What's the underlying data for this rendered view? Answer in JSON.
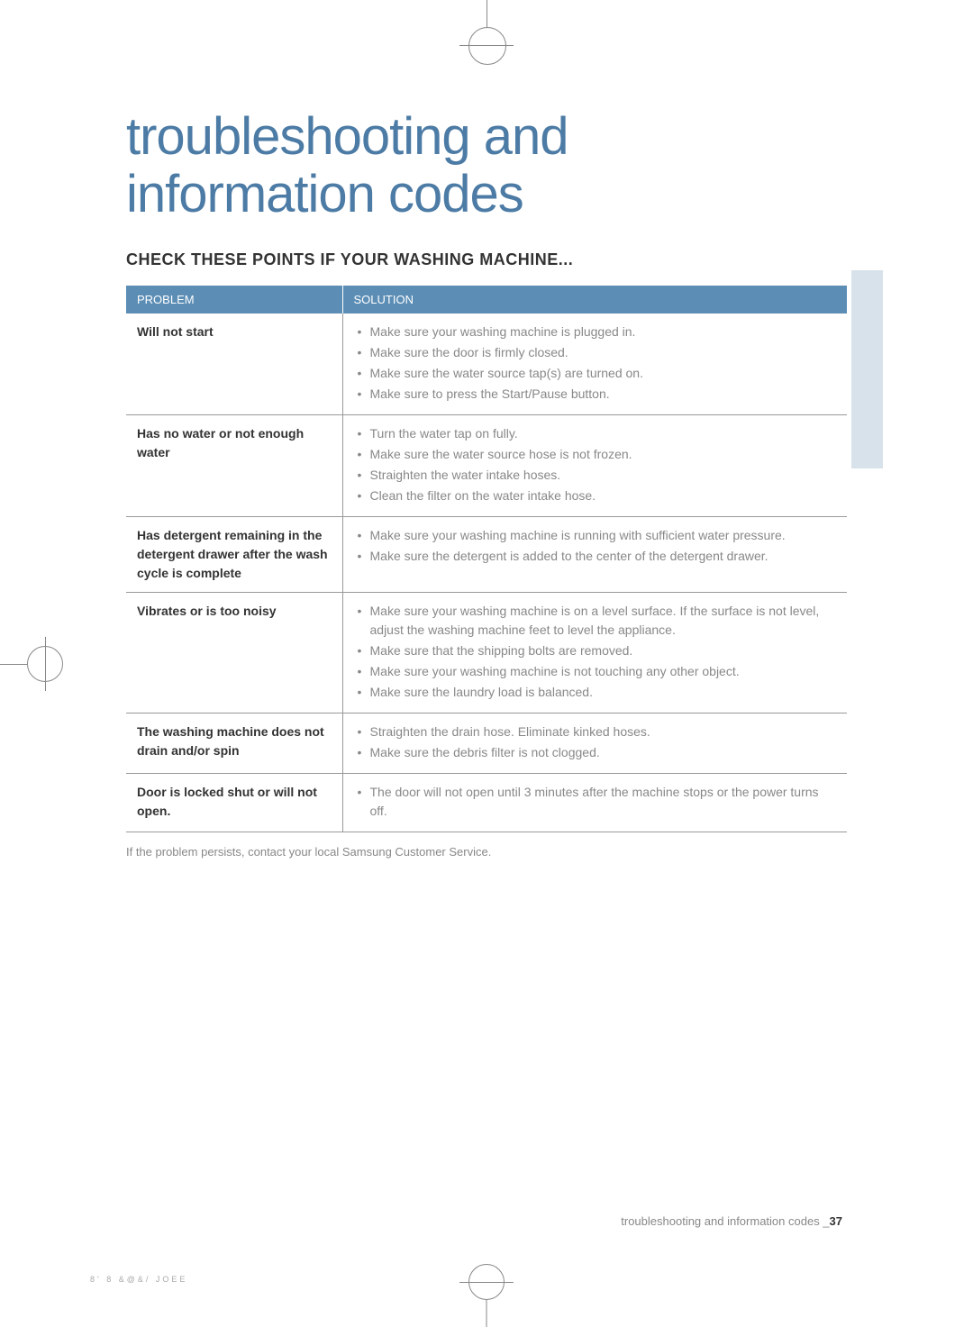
{
  "title_line1": "troubleshooting and",
  "title_line2": "information codes",
  "section_heading": "CHECK THESE POINTS IF YOUR WASHING MACHINE...",
  "table": {
    "headers": {
      "problem": "PROBLEM",
      "solution": "SOLUTION"
    },
    "rows": [
      {
        "problem": "Will not start",
        "solutions": [
          "Make sure your washing machine is plugged in.",
          "Make sure the door is firmly closed.",
          "Make sure the water source tap(s) are turned on.",
          "Make sure to press the Start/Pause button."
        ]
      },
      {
        "problem": "Has no water or not enough water",
        "solutions": [
          "Turn the water tap on fully.",
          "Make sure the water source hose is not frozen.",
          "Straighten the water intake hoses.",
          "Clean the filter on the water intake hose."
        ]
      },
      {
        "problem": "Has detergent remaining in the detergent drawer after the wash cycle is complete",
        "solutions": [
          "Make sure your washing machine is running with sufficient water pressure.",
          "Make sure the detergent is added to the center of the detergent drawer."
        ]
      },
      {
        "problem": "Vibrates or is too noisy",
        "solutions": [
          "Make sure your washing machine is on a level surface. If the surface is not level, adjust the washing machine feet to level the appliance.",
          "Make sure that the shipping bolts are removed.",
          "Make sure your washing machine is not touching any other object.",
          "Make sure the laundry load is balanced."
        ]
      },
      {
        "problem": "The washing machine does not drain and/or spin",
        "solutions": [
          "Straighten the drain hose. Eliminate kinked hoses.",
          "Make sure the debris filter is not clogged."
        ]
      },
      {
        "problem": "Door is locked shut or will not open.",
        "solutions": [
          "The door will not open until 3 minutes after the machine stops or the power turns off."
        ]
      }
    ]
  },
  "footer_note": "If the problem persists, contact your local Samsung Customer Service.",
  "page_footer_text": "troubleshooting and information codes _",
  "page_number": "37",
  "file_info": "8'    8    &@&/ JOEE"
}
